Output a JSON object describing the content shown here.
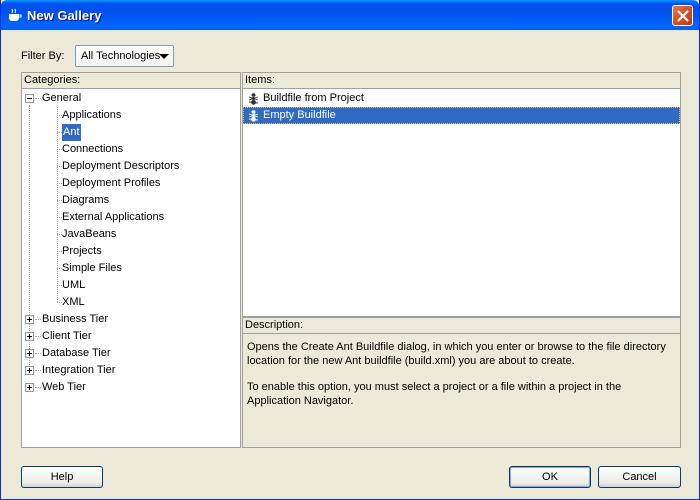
{
  "window": {
    "title": "New Gallery"
  },
  "filter": {
    "label": "Filter By:",
    "value": "All Technologies"
  },
  "categories": {
    "header": "Categories:",
    "general": {
      "label": "General",
      "children": [
        "Applications",
        "Ant",
        "Connections",
        "Deployment Descriptors",
        "Deployment Profiles",
        "Diagrams",
        "External Applications",
        "JavaBeans",
        "Projects",
        "Simple Files",
        "UML",
        "XML"
      ],
      "selected": "Ant"
    },
    "collapsed": [
      "Business Tier",
      "Client Tier",
      "Database Tier",
      "Integration Tier",
      "Web Tier"
    ]
  },
  "items": {
    "header": "Items:",
    "list": [
      "Buildfile from Project",
      "Empty Buildfile"
    ],
    "selected": "Empty Buildfile"
  },
  "description": {
    "header": "Description:",
    "para1": "Opens the Create Ant Buildfile dialog, in which you enter or browse to the file directory location for the new Ant buildfile (build.xml) you are about to create.",
    "para2": "To enable this option, you must select a project or a file within a project in the Application Navigator."
  },
  "buttons": {
    "help": "Help",
    "ok": "OK",
    "cancel": "Cancel"
  },
  "colors": {
    "selection": "#316ac5",
    "titlebar": "#0053ee",
    "dialog_bg": "#ece9d8"
  }
}
